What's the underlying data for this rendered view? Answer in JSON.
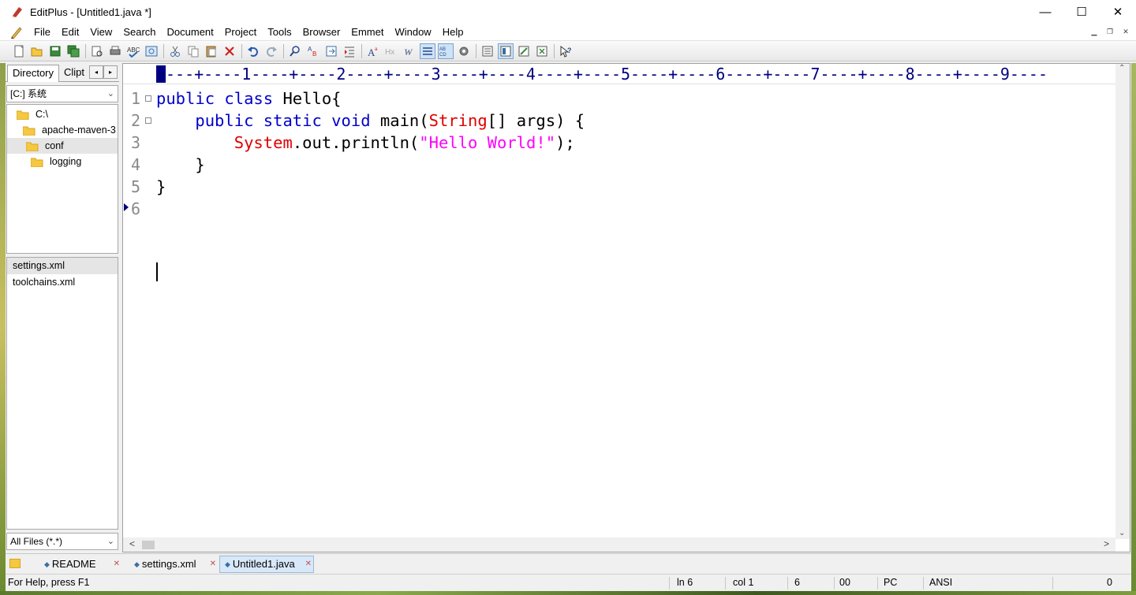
{
  "window": {
    "title": "EditPlus - [Untitled1.java *]",
    "minimize_glyph": "—",
    "maximize_glyph": "☐",
    "close_glyph": "✕"
  },
  "menu": {
    "items": [
      "File",
      "Edit",
      "View",
      "Search",
      "Document",
      "Project",
      "Tools",
      "Browser",
      "Emmet",
      "Window",
      "Help"
    ],
    "mdi_minimize": "▁",
    "mdi_restore": "❐",
    "mdi_close": "✕"
  },
  "toolbar": {
    "icons": [
      "new-file-icon",
      "open-file-icon",
      "save-icon",
      "save-all-icon",
      "print-preview-icon",
      "print-icon",
      "spell-check-icon",
      "browser-preview-icon",
      "cut-icon",
      "copy-icon",
      "paste-icon",
      "delete-icon",
      "undo-icon",
      "redo-icon",
      "find-icon",
      "replace-icon",
      "go-to-icon",
      "indent-icon",
      "font-icon",
      "hex-icon",
      "word-wrap-icon",
      "line-number-icon",
      "column-select-icon",
      "settings-icon",
      "view1-icon",
      "view2-icon",
      "view3-icon",
      "view4-icon",
      "help-icon"
    ]
  },
  "left_panel": {
    "tab_directory": "Directory",
    "tab_cliptext": "Clipt",
    "tab_prev": "◂",
    "tab_next": "▸",
    "drive": "[C:] 系统",
    "tree": [
      {
        "label": "C:\\",
        "selected": false
      },
      {
        "label": "apache-maven-3",
        "selected": false
      },
      {
        "label": "conf",
        "selected": true
      },
      {
        "label": "logging",
        "selected": false
      }
    ],
    "files": [
      {
        "label": "settings.xml",
        "selected": true
      },
      {
        "label": "toolchains.xml",
        "selected": false
      }
    ],
    "filter": "All Files (*.*)",
    "scroll_left": "<",
    "scroll_right": ">",
    "dropdown_glyph": "⌄"
  },
  "editor": {
    "ruler": "----+----1----+----2----+----3----+----4----+----5----+----6----+----7----+----8----+----9----",
    "line_numbers": [
      "1",
      "2",
      "3",
      "4",
      "5",
      "6"
    ],
    "fold_glyph": "⊟",
    "lines": [
      [
        {
          "t": "public class",
          "c": "kw"
        },
        {
          "t": " Hello{",
          "c": "txt"
        }
      ],
      [
        {
          "t": "    ",
          "c": "txt"
        },
        {
          "t": "public static void",
          "c": "kw"
        },
        {
          "t": " main(",
          "c": "txt"
        },
        {
          "t": "String",
          "c": "cls"
        },
        {
          "t": "[] args) {",
          "c": "txt"
        }
      ],
      [
        {
          "t": "        ",
          "c": "txt"
        },
        {
          "t": "System",
          "c": "cls"
        },
        {
          "t": ".out.println(",
          "c": "txt"
        },
        {
          "t": "\"Hello World!\"",
          "c": "str"
        },
        {
          "t": ");",
          "c": "txt"
        }
      ],
      [
        {
          "t": "    }",
          "c": "txt"
        }
      ],
      [
        {
          "t": "}",
          "c": "txt"
        }
      ],
      [
        {
          "t": "",
          "c": "txt"
        }
      ]
    ],
    "colors": {
      "keyword": "#0000cc",
      "class": "#e00000",
      "string": "#ff00ff"
    }
  },
  "doc_tabs": [
    {
      "label": "README",
      "active": false
    },
    {
      "label": "settings.xml",
      "active": false
    },
    {
      "label": "Untitled1.java",
      "active": true
    }
  ],
  "doc_tab_close": "✕",
  "doc_tab_dot": "◆",
  "status": {
    "help": "For Help, press F1",
    "line": "ln 6",
    "col": "col 1",
    "value1": "6",
    "value2": "00",
    "mode": "PC",
    "encoding": "ANSI",
    "modified": "0"
  }
}
